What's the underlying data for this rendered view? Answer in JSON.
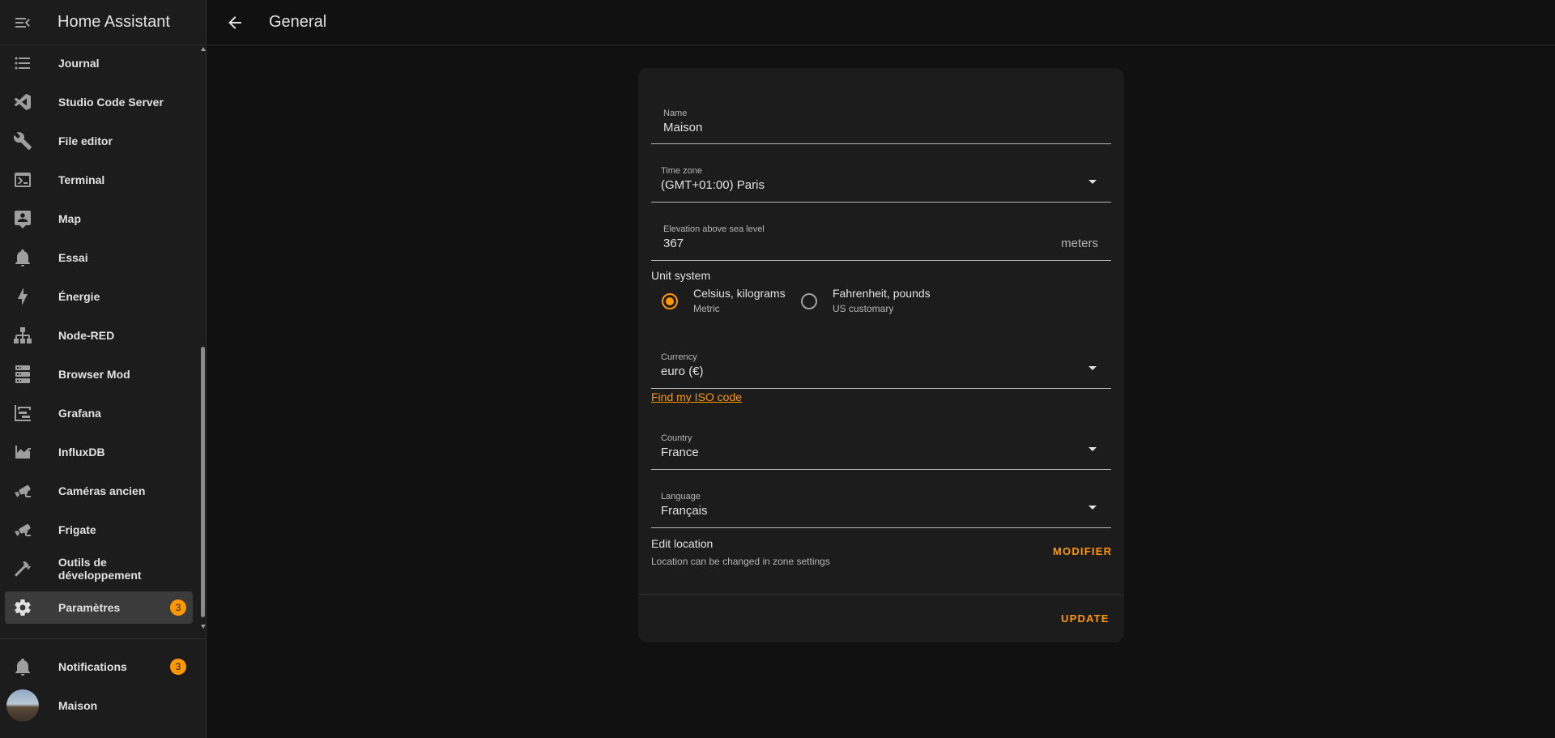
{
  "app": {
    "title": "Home Assistant"
  },
  "sidebar": {
    "items": [
      {
        "label": "Journal",
        "icon": "format-list-bulleted-icon"
      },
      {
        "label": "Studio Code Server",
        "icon": "visual-studio-code-icon"
      },
      {
        "label": "File editor",
        "icon": "wrench-icon"
      },
      {
        "label": "Terminal",
        "icon": "console-icon"
      },
      {
        "label": "Map",
        "icon": "map-account-icon"
      },
      {
        "label": "Essai",
        "icon": "bell-icon"
      },
      {
        "label": "Énergie",
        "icon": "lightning-bolt-icon"
      },
      {
        "label": "Node-RED",
        "icon": "sitemap-icon"
      },
      {
        "label": "Browser Mod",
        "icon": "server-icon"
      },
      {
        "label": "Grafana",
        "icon": "chart-timeline-icon"
      },
      {
        "label": "InfluxDB",
        "icon": "chart-areaspline-icon"
      },
      {
        "label": "Caméras ancien",
        "icon": "cctv-icon"
      },
      {
        "label": "Frigate",
        "icon": "cctv-icon"
      },
      {
        "label": "Outils de développement",
        "icon": "hammer-icon"
      },
      {
        "label": "Paramètres",
        "icon": "cog-icon",
        "badge": "3",
        "active": true
      }
    ],
    "notifications": {
      "label": "Notifications",
      "badge": "3"
    },
    "user": {
      "label": "Maison"
    }
  },
  "topbar": {
    "title": "General"
  },
  "form": {
    "name": {
      "label": "Name",
      "value": "Maison"
    },
    "timezone": {
      "label": "Time zone",
      "value": "(GMT+01:00) Paris"
    },
    "elevation": {
      "label": "Elevation above sea level",
      "value": "367",
      "suffix": "meters"
    },
    "unit_system": {
      "title": "Unit system",
      "options": [
        {
          "label": "Celsius, kilograms",
          "sub": "Metric",
          "checked": true
        },
        {
          "label": "Fahrenheit, pounds",
          "sub": "US customary",
          "checked": false
        }
      ]
    },
    "currency": {
      "label": "Currency",
      "value": "euro (€)"
    },
    "iso_link": "Find my ISO code",
    "country": {
      "label": "Country",
      "value": "France"
    },
    "language": {
      "label": "Language",
      "value": "Français"
    },
    "location": {
      "title": "Edit location",
      "sub": "Location can be changed in zone settings",
      "button": "Modifier"
    },
    "update_button": "Update"
  },
  "colors": {
    "accent": "#ff9800",
    "background": "#111111",
    "card": "#1c1c1c"
  }
}
